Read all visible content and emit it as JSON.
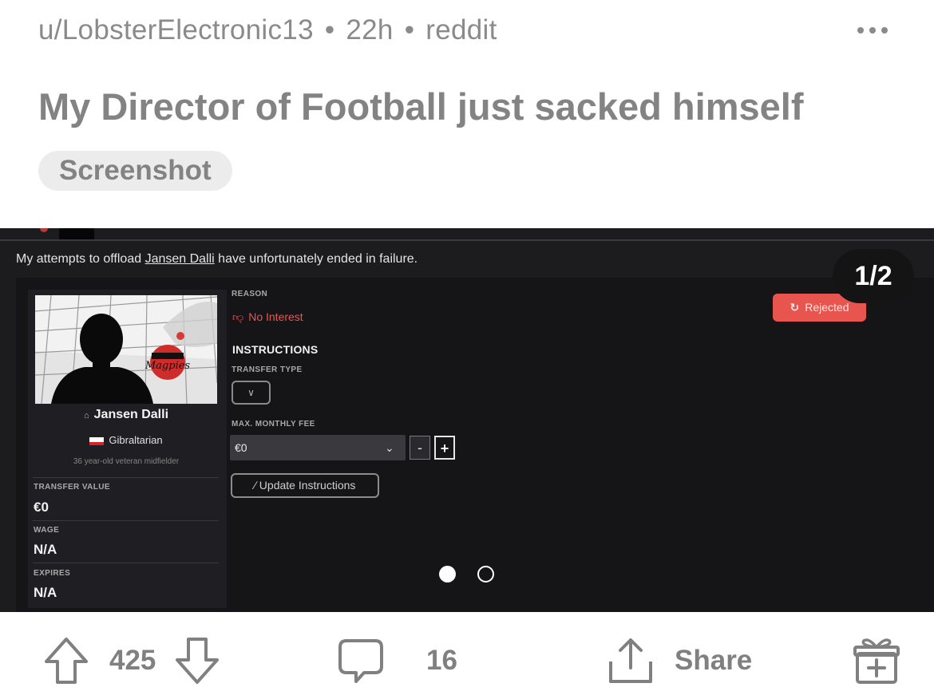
{
  "post": {
    "username": "u/LobsterElectronic13",
    "age": "22h",
    "source": "reddit",
    "title": "My Director of Football just sacked himself",
    "flair": "Screenshot"
  },
  "media": {
    "counter": "1/2",
    "caption_before": "My attempts to offload ",
    "caption_player": "Jansen Dalli",
    "caption_after": " have unfortunately ended in failure.",
    "player": {
      "name": "Jansen Dalli",
      "nationality": "Gibraltarian",
      "description": "36 year-old veteran midfielder",
      "club_badge_text": "Magpies",
      "transfer_value_label": "TRANSFER VALUE",
      "transfer_value": "€0",
      "wage_label": "WAGE",
      "wage": "N/A",
      "expires_label": "EXPIRES",
      "expires": "N/A"
    },
    "reason_label": "REASON",
    "reason_value": "No Interest",
    "instructions_heading": "INSTRUCTIONS",
    "transfer_type_label": "TRANSFER TYPE",
    "max_fee_label": "MAX. MONTHLY FEE",
    "max_fee_value": "€0",
    "minus": "-",
    "plus": "+",
    "update_button": "Update Instructions",
    "status": "Rejected",
    "status_color": "#e8554f",
    "slides": {
      "current": 1,
      "total": 2
    }
  },
  "actions": {
    "upvotes": "425",
    "comments": "16",
    "share": "Share"
  },
  "icons": [
    "more-icon",
    "upvote-icon",
    "downvote-icon",
    "comment-icon",
    "share-icon",
    "award-icon",
    "thumbs-down-icon",
    "refresh-icon",
    "chevron-down-icon",
    "person-icon",
    "pencil-icon"
  ]
}
